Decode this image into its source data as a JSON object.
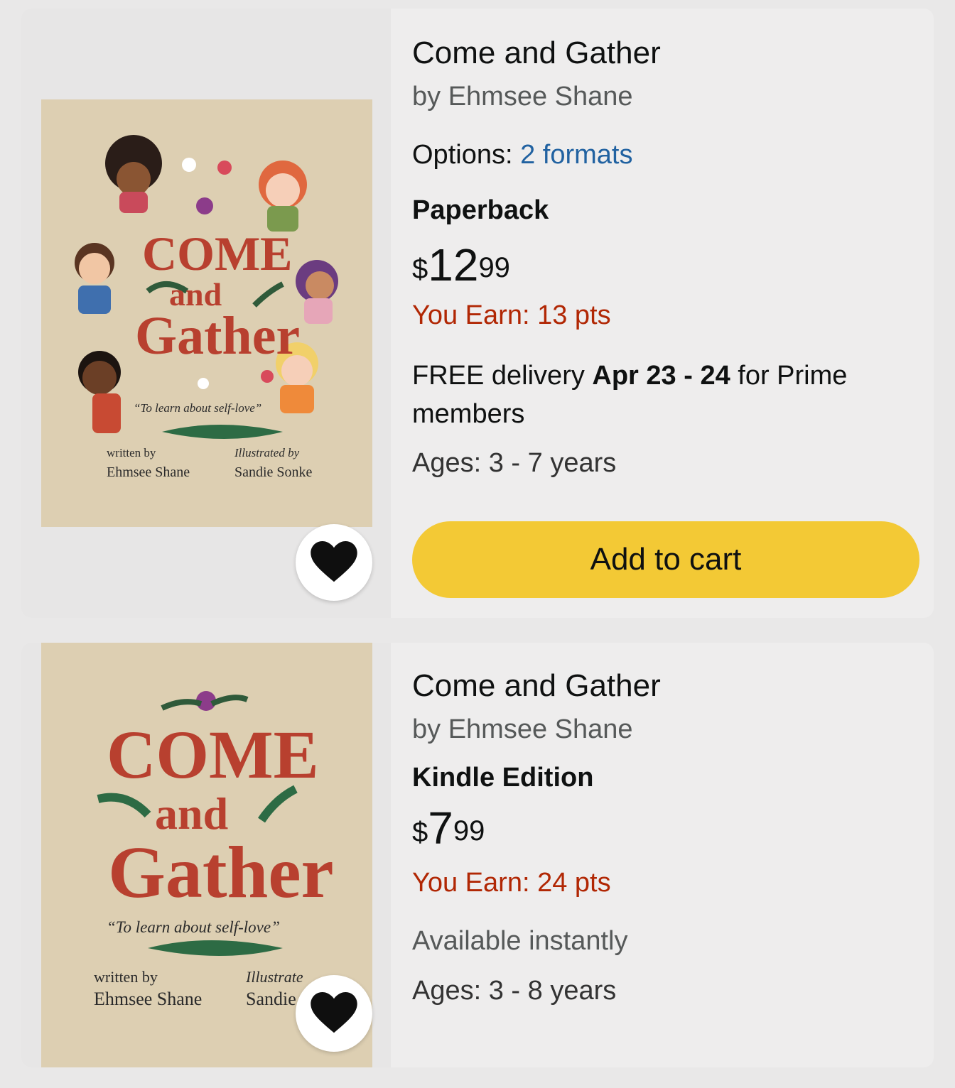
{
  "products": [
    {
      "title": "Come and Gather",
      "byline": "by Ehmsee Shane",
      "options_label": "Options:",
      "options_link": "2 formats",
      "format": "Paperback",
      "price_symbol": "$",
      "price_whole": "12",
      "price_fraction": "99",
      "earn": "You Earn: 13 pts",
      "delivery_prefix": "FREE delivery ",
      "delivery_dates": "Apr 23 - 24",
      "delivery_suffix": " for Prime",
      "delivery_line2": "members",
      "ages": "Ages: 3 - 7 years",
      "cart_label": "Add to cart",
      "cover": {
        "title_line1": "COME",
        "title_line2": "and",
        "title_line3": "Gather",
        "tagline": "“To learn about self-love”",
        "written_by_label": "written by",
        "author": "Ehmsee Shane",
        "illustrated_by_label": "Illustrated by",
        "illustrator": "Sandie Sonke"
      }
    },
    {
      "title": "Come and Gather",
      "byline": "by Ehmsee Shane",
      "format": "Kindle Edition",
      "price_symbol": "$",
      "price_whole": "7",
      "price_fraction": "99",
      "earn": "You Earn: 24 pts",
      "availability": "Available instantly",
      "ages": "Ages: 3 - 8 years",
      "cover": {
        "title_line1": "COME",
        "title_line2": "and",
        "title_line3": "Gather",
        "tagline": "“To learn about self-love”",
        "written_by_label": "written by",
        "author": "Ehmsee Shane",
        "illustrated_by_label": "Illustrate",
        "illustrator": "Sandie"
      }
    }
  ],
  "colors": {
    "cover_bg": "#ddcfb2",
    "title_red": "#b8402f",
    "link_blue": "#2162a1",
    "earn_red": "#b12704",
    "cart_yellow": "#f3c935"
  },
  "icons": {
    "favorite": "heart-icon"
  }
}
